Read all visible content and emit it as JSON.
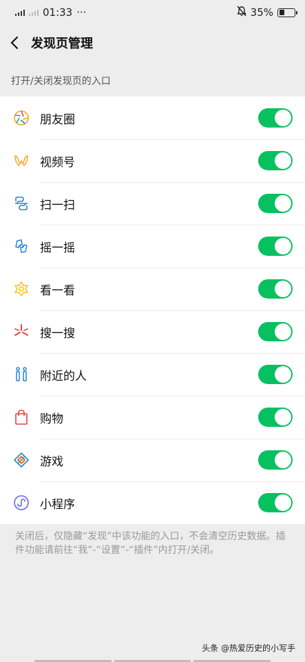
{
  "status_bar": {
    "time": "01:33",
    "more": "···",
    "battery_percent": "35%",
    "battery_level": 0.35
  },
  "header": {
    "title": "发现页管理"
  },
  "section": {
    "label": "打开/关闭发现页的入口"
  },
  "items": [
    {
      "label": "朋友圈",
      "icon": "moments-icon",
      "enabled": true
    },
    {
      "label": "视频号",
      "icon": "channels-icon",
      "enabled": true
    },
    {
      "label": "扫一扫",
      "icon": "scan-icon",
      "enabled": true
    },
    {
      "label": "摇一摇",
      "icon": "shake-icon",
      "enabled": true
    },
    {
      "label": "看一看",
      "icon": "top-stories-icon",
      "enabled": true
    },
    {
      "label": "搜一搜",
      "icon": "search-icon",
      "enabled": true
    },
    {
      "label": "附近的人",
      "icon": "people-nearby-icon",
      "enabled": true
    },
    {
      "label": "购物",
      "icon": "shopping-bag-icon",
      "enabled": true
    },
    {
      "label": "游戏",
      "icon": "games-icon",
      "enabled": true
    },
    {
      "label": "小程序",
      "icon": "mini-programs-icon",
      "enabled": true
    }
  ],
  "footnote": "关闭后，仅隐藏“发现”中该功能的入口，不会清空历史数据。插件功能请前往“我”-“设置”-“插件”内打开/关闭。",
  "watermark": "头条 @热爱历史的小写手",
  "colors": {
    "toggle_on": "#07c160",
    "background": "#ededed"
  }
}
